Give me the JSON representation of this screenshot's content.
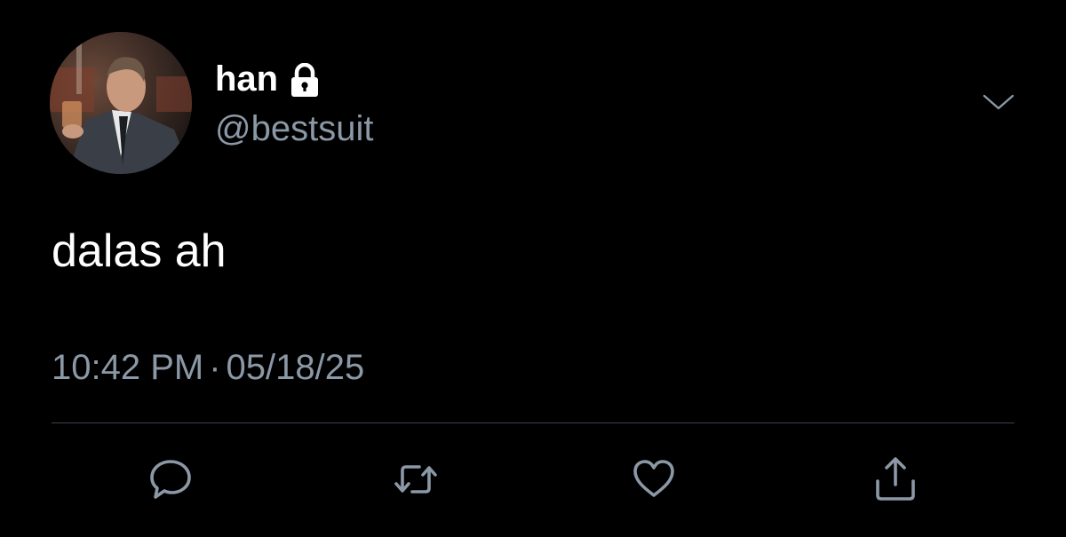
{
  "tweet": {
    "author": {
      "display_name": "han",
      "handle": "@bestsuit",
      "protected_icon": "lock-icon",
      "avatar": "profile-photo"
    },
    "menu_icon": "chevron-down-icon",
    "text": "dalas ah",
    "time": "10:42 PM",
    "separator": "·",
    "date": "05/18/25",
    "actions": [
      {
        "name": "reply",
        "icon": "reply-icon"
      },
      {
        "name": "retweet",
        "icon": "retweet-icon"
      },
      {
        "name": "like",
        "icon": "heart-icon"
      },
      {
        "name": "share",
        "icon": "share-icon"
      }
    ]
  },
  "colors": {
    "background": "#000000",
    "primary_text": "#ffffff",
    "secondary_text": "#8b98a5",
    "divider": "#38444d"
  }
}
